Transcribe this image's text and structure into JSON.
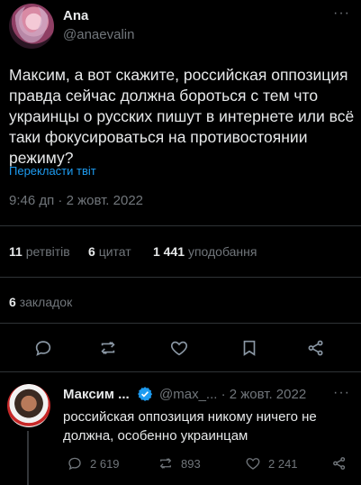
{
  "tweet": {
    "author_name": "Ana",
    "author_handle": "@anaevalin",
    "more_label": "···",
    "text": "Максим, а вот скажите, российская оппозиция правда сейчас должна бороться с тем что украинцы о русских пишут в интернете или всё таки фокусироваться на противостоянии режиму?",
    "translate_label": "Перекласти твіт",
    "timestamp": "9:46 дп · 2 жовт. 2022"
  },
  "stats": {
    "retweets_count": "11",
    "retweets_label": "ретвітів",
    "quotes_count": "6",
    "quotes_label": "цитат",
    "likes_count": "1 441",
    "likes_label": "уподобання",
    "bookmarks_count": "6",
    "bookmarks_label": "закладок"
  },
  "actions": {
    "icons": [
      "reply-icon",
      "retweet-icon",
      "like-icon",
      "bookmark-icon",
      "share-icon"
    ]
  },
  "reply": {
    "author_name": "Максим ...",
    "author_handle": "@max_... · 2 жовт. 2022",
    "more_label": "···",
    "text": "российская оппозиция никому ничего не должна, особенно украинцам",
    "replies": "2 619",
    "retweets": "893",
    "likes": "2 241"
  },
  "colors": {
    "background": "#000000",
    "text": "#e7e9ea",
    "muted": "#71767b",
    "link": "#1d9bf0",
    "divider": "#2f3336"
  }
}
